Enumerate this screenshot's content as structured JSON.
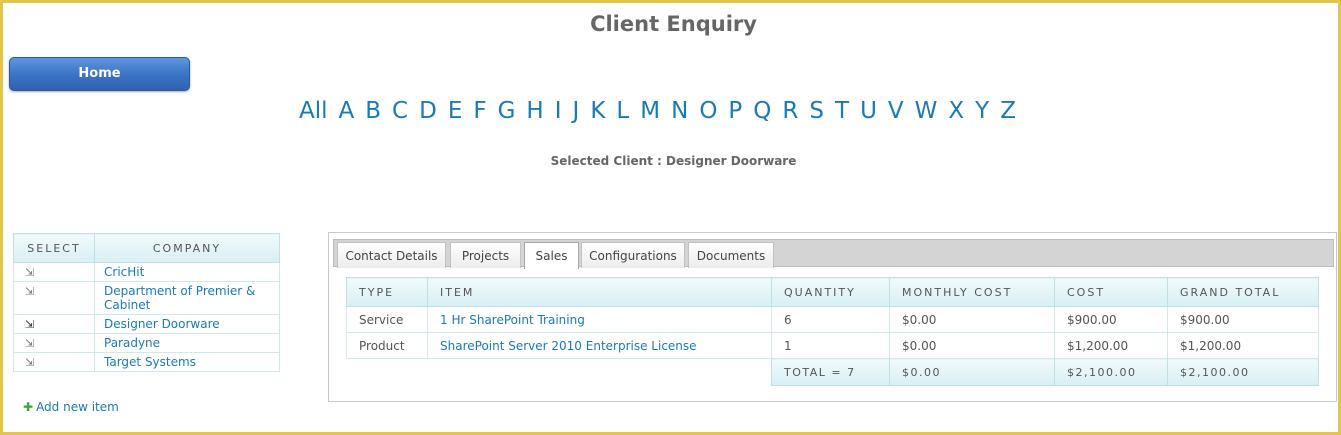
{
  "page": {
    "title": "Client Enquiry"
  },
  "home_button": {
    "label": "Home"
  },
  "alphabet": [
    "All",
    "A",
    "B",
    "C",
    "D",
    "E",
    "F",
    "G",
    "H",
    "I",
    "J",
    "K",
    "L",
    "M",
    "N",
    "O",
    "P",
    "Q",
    "R",
    "S",
    "T",
    "U",
    "V",
    "W",
    "X",
    "Y",
    "Z"
  ],
  "selected_client": {
    "text": "Selected Client : Designer Doorware"
  },
  "client_table": {
    "headers": {
      "select": "SELECT",
      "company": "COMPANY"
    },
    "rows": [
      {
        "select_icon": "select-arrow-icon",
        "company": "CricHit"
      },
      {
        "select_icon": "select-arrow-icon",
        "company": "Department of Premier & Cabinet"
      },
      {
        "select_icon": "select-arrow-icon",
        "company": "Designer Doorware"
      },
      {
        "select_icon": "select-arrow-icon",
        "company": "Paradyne"
      },
      {
        "select_icon": "select-arrow-icon",
        "company": "Target Systems"
      }
    ]
  },
  "add_new_item": {
    "label": "Add new item"
  },
  "tabs": [
    {
      "label": "Contact Details"
    },
    {
      "label": "Projects"
    },
    {
      "label": "Sales"
    },
    {
      "label": "Configurations"
    },
    {
      "label": "Documents"
    }
  ],
  "sales_table": {
    "headers": {
      "type": "TYPE",
      "item": "ITEM",
      "quantity": "QUANTITY",
      "monthly_cost": "MONTHLY COST",
      "cost": "COST",
      "grand_total": "GRAND TOTAL"
    },
    "rows": [
      {
        "type": "Service",
        "item": "1 Hr SharePoint Training",
        "quantity": "6",
        "monthly_cost": "$0.00",
        "cost": "$900.00",
        "grand_total": "$900.00"
      },
      {
        "type": "Product",
        "item": "SharePoint Server 2010 Enterprise License",
        "quantity": "1",
        "monthly_cost": "$0.00",
        "cost": "$1,200.00",
        "grand_total": "$1,200.00"
      }
    ],
    "totals": {
      "quantity": "TOTAL = 7",
      "monthly_cost": "$0.00",
      "cost": "$2,100.00",
      "grand_total": "$2,100.00"
    }
  },
  "colors": {
    "accent_link": "#1a7ab8",
    "frame_border": "#e2c64a",
    "button_blue": "#3a72c5"
  }
}
